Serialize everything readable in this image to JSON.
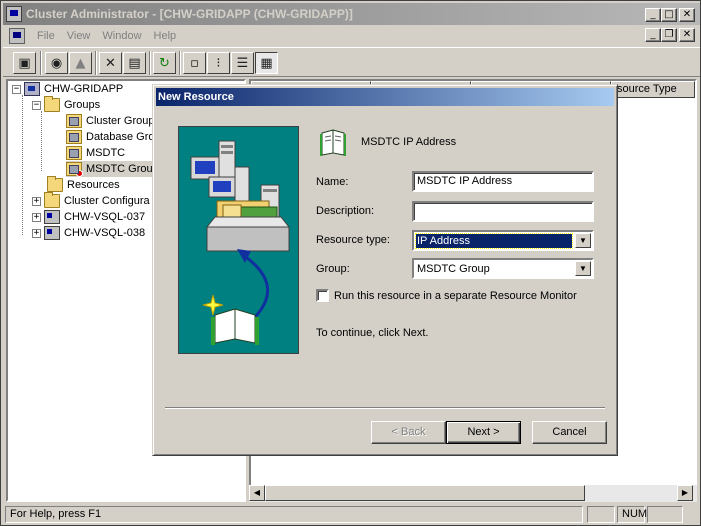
{
  "window": {
    "title": "Cluster Administrator - [CHW-GRIDAPP (CHW-GRIDAPP)]",
    "controls": {
      "minimize": "_",
      "maximize": "□",
      "close": "✕"
    },
    "mdi_controls": {
      "minimize": "_",
      "restore": "❐",
      "close": "✕"
    }
  },
  "menubar": {
    "items": [
      {
        "label": "File"
      },
      {
        "label": "View"
      },
      {
        "label": "Window"
      },
      {
        "label": "Help"
      }
    ]
  },
  "toolbar": {
    "buttons": [
      {
        "icon": "open-connection-icon",
        "glyph": "▣"
      },
      {
        "icon": "bring-online-icon",
        "glyph": "◉"
      },
      {
        "icon": "take-offline-icon",
        "glyph": "▲"
      },
      {
        "icon": "delete-icon",
        "glyph": "✕"
      },
      {
        "icon": "properties-icon",
        "glyph": "▤"
      },
      {
        "icon": "refresh-icon",
        "glyph": "↻"
      },
      {
        "icon": "large-icons-icon",
        "glyph": "▫"
      },
      {
        "icon": "small-icons-icon",
        "glyph": "⁝"
      },
      {
        "icon": "list-view-icon",
        "glyph": "☰"
      },
      {
        "icon": "details-view-icon",
        "glyph": "▦"
      }
    ]
  },
  "tree": {
    "root": "CHW-GRIDAPP",
    "groups_label": "Groups",
    "groups": [
      "Cluster Group",
      "Database Gro",
      "MSDTC",
      "MSDTC Group"
    ],
    "resources_label": "Resources",
    "config_label": "Cluster Configura",
    "nodes": [
      "CHW-VSQL-037",
      "CHW-VSQL-038"
    ],
    "expander_plus": "+",
    "expander_minus": "−"
  },
  "list": {
    "column_partial": "source Type"
  },
  "scrollbar": {
    "left": "◀",
    "right": "▶"
  },
  "statusbar": {
    "help_text": "For Help, press F1",
    "num": "NUM"
  },
  "dialog": {
    "title": "New Resource",
    "resource_heading": "MSDTC IP Address",
    "name_label": "Name:",
    "name_value": "MSDTC IP Address",
    "description_label": "Description:",
    "description_value": "",
    "resource_type_label": "Resource type:",
    "resource_type_value": "IP Address",
    "group_label": "Group:",
    "group_value": "MSDTC Group",
    "separate_monitor_label": "Run this resource in a separate Resource Monitor",
    "separate_monitor_checked": false,
    "instruction": "To continue, click Next.",
    "back_label": "< Back",
    "next_label": "Next >",
    "cancel_label": "Cancel",
    "dropdown_arrow": "▼"
  },
  "colors": {
    "dialog_title_start": "#0a246a",
    "dialog_title_end": "#a6caf0",
    "wizard_bg": "#008080",
    "inactive_title": "#808080"
  }
}
